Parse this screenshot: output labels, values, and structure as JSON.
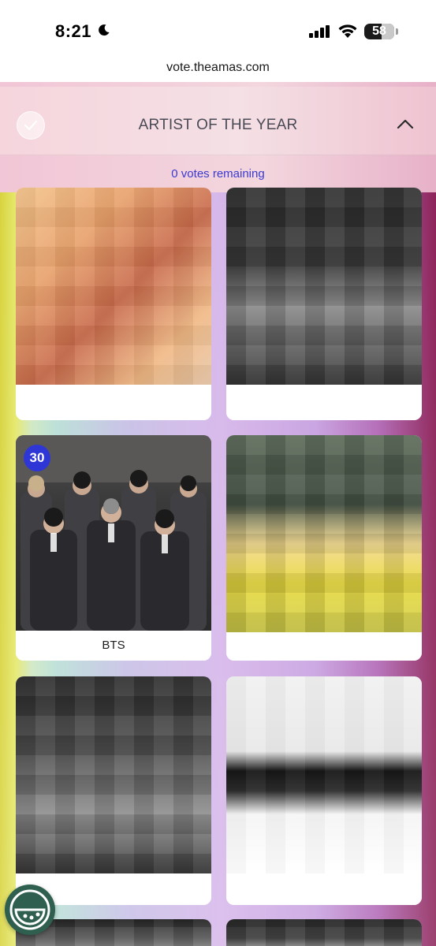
{
  "status_bar": {
    "time": "8:21",
    "battery": "58",
    "battery_level": 0.58
  },
  "browser": {
    "url": "vote.theamas.com"
  },
  "section": {
    "title": "ARTIST OF THE YEAR",
    "votes_remaining": "0 votes remaining"
  },
  "cards": [
    {
      "label": "",
      "photo": "pixelated-photo"
    },
    {
      "label": "",
      "photo": "pixelated-photo"
    },
    {
      "label": "BTS",
      "badge": "30",
      "photo": "bts-group-photo"
    },
    {
      "label": "",
      "photo": "pixelated-photo"
    },
    {
      "label": "",
      "photo": "pixelated-photo"
    },
    {
      "label": "",
      "photo": "pixelated-photo"
    }
  ],
  "colors": {
    "accent": "#2f36d6",
    "votes_text": "#3b3ad2",
    "fab": "#2e5f4f"
  }
}
